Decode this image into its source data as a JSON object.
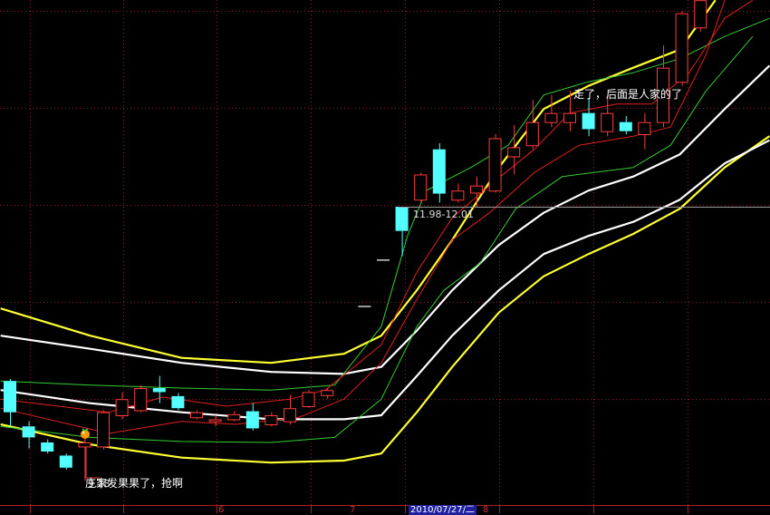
{
  "chart_data": {
    "type": "candlestick",
    "title": "",
    "colors": {
      "up": "#ff3b3b",
      "down": "#54ffff",
      "grid": "#8a2020",
      "crosshair": "#9a9a9a",
      "yellow": "#ffff33",
      "white": "#ffffff",
      "green": "#33cc33",
      "red": "#e02020",
      "background": "#000000"
    },
    "ylim": [
      9.0,
      14.05
    ],
    "candles": [
      {
        "o": 10.27,
        "c": 9.96,
        "h": 10.29,
        "l": 9.82
      },
      {
        "o": 9.82,
        "c": 9.71,
        "h": 9.87,
        "l": 9.6
      },
      {
        "o": 9.66,
        "c": 9.57,
        "h": 9.69,
        "l": 9.55
      },
      {
        "o": 9.53,
        "c": 9.41,
        "h": 9.55,
        "l": 9.39
      },
      {
        "o": 9.62,
        "c": 9.66,
        "h": 9.75,
        "l": 9.28
      },
      {
        "o": 9.62,
        "c": 9.96,
        "h": 9.98,
        "l": 9.59
      },
      {
        "o": 9.93,
        "c": 10.09,
        "h": 10.16,
        "l": 9.89
      },
      {
        "o": 9.98,
        "c": 10.2,
        "h": 10.23,
        "l": 9.96
      },
      {
        "o": 10.2,
        "c": 10.16,
        "h": 10.32,
        "l": 10.05
      },
      {
        "o": 10.12,
        "c": 10.0,
        "h": 10.15,
        "l": 9.98
      },
      {
        "o": 9.91,
        "c": 9.96,
        "h": 9.98,
        "l": 9.89
      },
      {
        "o": 9.88,
        "c": 9.89,
        "h": 9.93,
        "l": 9.82
      },
      {
        "o": 9.89,
        "c": 9.94,
        "h": 9.97,
        "l": 9.87
      },
      {
        "o": 9.97,
        "c": 9.8,
        "h": 10.05,
        "l": 9.78
      },
      {
        "o": 9.84,
        "c": 9.93,
        "h": 9.96,
        "l": 9.82
      },
      {
        "o": 9.87,
        "c": 10.0,
        "h": 10.13,
        "l": 9.84
      },
      {
        "o": 10.02,
        "c": 10.16,
        "h": 10.18,
        "l": 10.0
      },
      {
        "o": 10.13,
        "c": 10.18,
        "h": 10.2,
        "l": 10.09
      },
      null,
      {
        "o": 11.01,
        "c": 11.01,
        "h": 11.01,
        "l": 11.01
      },
      {
        "o": 11.47,
        "c": 11.47,
        "h": 11.47,
        "l": 11.47
      },
      {
        "o": 12.0,
        "c": 11.76,
        "h": 12.0,
        "l": 11.51
      },
      {
        "o": 12.07,
        "c": 12.32,
        "h": 12.34,
        "l": 12.05
      },
      {
        "o": 12.57,
        "c": 12.13,
        "h": 12.63,
        "l": 12.04
      },
      {
        "o": 12.07,
        "c": 12.16,
        "h": 12.23,
        "l": 12.04
      },
      {
        "o": 12.14,
        "c": 12.21,
        "h": 12.3,
        "l": 12.0
      },
      {
        "o": 12.16,
        "c": 12.68,
        "h": 12.72,
        "l": 12.14
      },
      {
        "o": 12.5,
        "c": 12.59,
        "h": 12.81,
        "l": 12.32
      },
      {
        "o": 12.61,
        "c": 12.84,
        "h": 13.06,
        "l": 12.57
      },
      {
        "o": 12.84,
        "c": 12.93,
        "h": 13.11,
        "l": 12.79
      },
      {
        "o": 12.84,
        "c": 12.93,
        "h": 13.15,
        "l": 12.75
      },
      {
        "o": 12.93,
        "c": 12.77,
        "h": 13.08,
        "l": 12.7
      },
      {
        "o": 12.75,
        "c": 12.93,
        "h": 13.11,
        "l": 12.7
      },
      {
        "o": 12.84,
        "c": 12.75,
        "h": 12.9,
        "l": 12.72
      },
      {
        "o": 12.72,
        "c": 12.84,
        "h": 12.93,
        "l": 12.57
      },
      {
        "o": 12.84,
        "c": 13.38,
        "h": 13.6,
        "l": 12.79
      },
      {
        "o": 13.24,
        "c": 13.92,
        "h": 13.94,
        "l": 13.2
      },
      {
        "o": 13.78,
        "c": 14.05,
        "h": 14.05,
        "l": 13.74
      }
    ],
    "series": [
      {
        "name": "yellow-upper",
        "color": "#ffff33",
        "width": 2.2,
        "points": [
          [
            -0.5,
            10.99
          ],
          [
            4.3,
            10.72
          ],
          [
            9.2,
            10.5
          ],
          [
            14.0,
            10.45
          ],
          [
            17.9,
            10.54
          ],
          [
            19.9,
            10.72
          ],
          [
            21.8,
            11.17
          ],
          [
            23.7,
            11.67
          ],
          [
            26.2,
            12.39
          ],
          [
            28.6,
            12.97
          ],
          [
            31.0,
            13.2
          ],
          [
            33.4,
            13.38
          ],
          [
            35.9,
            13.56
          ],
          [
            37.8,
            14.05
          ]
        ]
      },
      {
        "name": "yellow-lower",
        "color": "#ffff33",
        "width": 2.2,
        "points": [
          [
            -0.5,
            9.84
          ],
          [
            4.3,
            9.64
          ],
          [
            9.2,
            9.51
          ],
          [
            14.0,
            9.46
          ],
          [
            17.9,
            9.48
          ],
          [
            19.9,
            9.55
          ],
          [
            21.8,
            9.96
          ],
          [
            23.7,
            10.41
          ],
          [
            26.2,
            10.95
          ],
          [
            28.6,
            11.31
          ],
          [
            31.0,
            11.53
          ],
          [
            33.4,
            11.73
          ],
          [
            35.9,
            11.98
          ],
          [
            38.3,
            12.39
          ],
          [
            40.7,
            12.7
          ]
        ]
      },
      {
        "name": "white-upper",
        "color": "#ffffff",
        "width": 2.2,
        "points": [
          [
            -0.5,
            10.72
          ],
          [
            4.3,
            10.59
          ],
          [
            9.2,
            10.45
          ],
          [
            14.0,
            10.36
          ],
          [
            17.9,
            10.34
          ],
          [
            19.9,
            10.41
          ],
          [
            21.8,
            10.77
          ],
          [
            23.7,
            11.17
          ],
          [
            26.2,
            11.62
          ],
          [
            28.6,
            11.94
          ],
          [
            31.0,
            12.16
          ],
          [
            33.4,
            12.3
          ],
          [
            35.9,
            12.52
          ],
          [
            38.3,
            12.97
          ],
          [
            40.7,
            13.4
          ]
        ]
      },
      {
        "name": "white-lower",
        "color": "#ffffff",
        "width": 2.2,
        "points": [
          [
            -0.5,
            10.18
          ],
          [
            4.3,
            10.05
          ],
          [
            9.2,
            9.96
          ],
          [
            14.0,
            9.89
          ],
          [
            17.9,
            9.89
          ],
          [
            19.9,
            9.93
          ],
          [
            21.8,
            10.32
          ],
          [
            23.7,
            10.72
          ],
          [
            26.2,
            11.17
          ],
          [
            28.6,
            11.53
          ],
          [
            31.0,
            11.71
          ],
          [
            33.4,
            11.85
          ],
          [
            35.9,
            12.07
          ],
          [
            38.3,
            12.43
          ],
          [
            40.7,
            12.66
          ]
        ]
      },
      {
        "name": "green-upper",
        "color": "#33cc33",
        "width": 1,
        "points": [
          [
            -0.5,
            10.27
          ],
          [
            4.3,
            10.23
          ],
          [
            9.2,
            10.2
          ],
          [
            14.0,
            10.18
          ],
          [
            17.4,
            10.23
          ],
          [
            19.9,
            10.81
          ],
          [
            21.3,
            11.71
          ],
          [
            22.3,
            12.16
          ],
          [
            24.7,
            12.39
          ],
          [
            26.7,
            12.61
          ],
          [
            28.6,
            13.11
          ],
          [
            31.0,
            13.24
          ],
          [
            33.4,
            13.33
          ],
          [
            35.9,
            13.47
          ],
          [
            38.3,
            13.69
          ],
          [
            40.7,
            13.87
          ]
        ]
      },
      {
        "name": "green-lower",
        "color": "#33cc33",
        "width": 1,
        "points": [
          [
            -0.5,
            9.82
          ],
          [
            4.3,
            9.71
          ],
          [
            9.2,
            9.67
          ],
          [
            14.0,
            9.66
          ],
          [
            17.4,
            9.71
          ],
          [
            19.9,
            10.09
          ],
          [
            21.8,
            10.81
          ],
          [
            23.25,
            11.17
          ],
          [
            25.2,
            11.44
          ],
          [
            27.1,
            11.98
          ],
          [
            29.6,
            12.3
          ],
          [
            33.4,
            12.39
          ],
          [
            35.4,
            12.61
          ],
          [
            37.3,
            13.15
          ],
          [
            39.8,
            13.69
          ]
        ]
      },
      {
        "name": "red-upper",
        "color": "#e02020",
        "width": 1,
        "points": [
          [
            -0.5,
            10.09
          ],
          [
            5.3,
            9.96
          ],
          [
            8.2,
            10.11
          ],
          [
            11.6,
            10.02
          ],
          [
            15.0,
            10.09
          ],
          [
            16.9,
            10.18
          ],
          [
            19.9,
            10.63
          ],
          [
            21.8,
            11.35
          ],
          [
            23.7,
            11.89
          ],
          [
            25.7,
            12.21
          ],
          [
            28.1,
            12.57
          ],
          [
            30.0,
            12.93
          ],
          [
            32.5,
            13.02
          ],
          [
            34.4,
            13.02
          ],
          [
            36.4,
            13.33
          ],
          [
            38.3,
            13.87
          ],
          [
            39.8,
            14.05
          ]
        ]
      },
      {
        "name": "red-lower",
        "color": "#e02020",
        "width": 1,
        "points": [
          [
            -0.5,
            10.0
          ],
          [
            5.3,
            9.75
          ],
          [
            9.2,
            9.87
          ],
          [
            12.1,
            9.84
          ],
          [
            15.5,
            9.91
          ],
          [
            17.9,
            10.09
          ],
          [
            19.9,
            10.45
          ],
          [
            21.8,
            11.08
          ],
          [
            23.7,
            11.67
          ],
          [
            25.7,
            11.94
          ],
          [
            28.1,
            12.34
          ],
          [
            30.5,
            12.61
          ],
          [
            33.4,
            12.7
          ],
          [
            35.4,
            12.79
          ],
          [
            37.3,
            13.51
          ],
          [
            38.3,
            14.05
          ]
        ]
      }
    ],
    "crosshair_price": 12.0,
    "x_tick_labels": [
      "6",
      "7",
      "2010/07/27/二",
      "8"
    ],
    "annotations": {
      "low_price": "9.28",
      "buy_note": "庄家发果果了，抢啊",
      "sell_note": "走了，后面是人家的了",
      "crosshair_range": "11.98-12.01"
    }
  }
}
